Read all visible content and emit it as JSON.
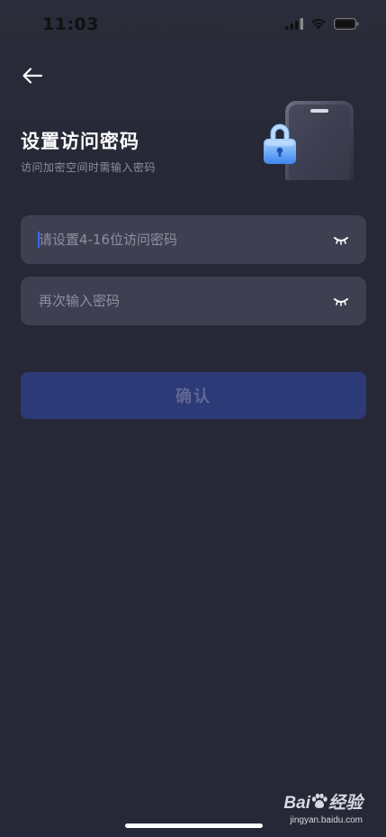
{
  "status_bar": {
    "time": "11:03",
    "icons": [
      "cellular-signal-icon",
      "wifi-icon",
      "battery-icon"
    ]
  },
  "nav": {
    "back_icon": "arrow-left-icon"
  },
  "header": {
    "title": "设置访问密码",
    "subtitle": "访问加密空间时需输入密码",
    "illustration": "phone-lock-icon"
  },
  "form": {
    "password": {
      "placeholder": "请设置4-16位访问密码",
      "value": "",
      "toggle_icon": "eye-closed-icon"
    },
    "confirm_password": {
      "placeholder": "再次输入密码",
      "value": "",
      "toggle_icon": "eye-closed-icon"
    },
    "confirm_label": "确认"
  },
  "watermark": {
    "logo_text_a": "Bai",
    "logo_text_b": "经验",
    "url": "jingyan.baidu.com"
  },
  "colors": {
    "background": "#262836",
    "field": "#3e4052",
    "button_disabled": "#2d3a78",
    "button_text_disabled": "#5f6794",
    "accent_caret": "#3c64ff"
  }
}
